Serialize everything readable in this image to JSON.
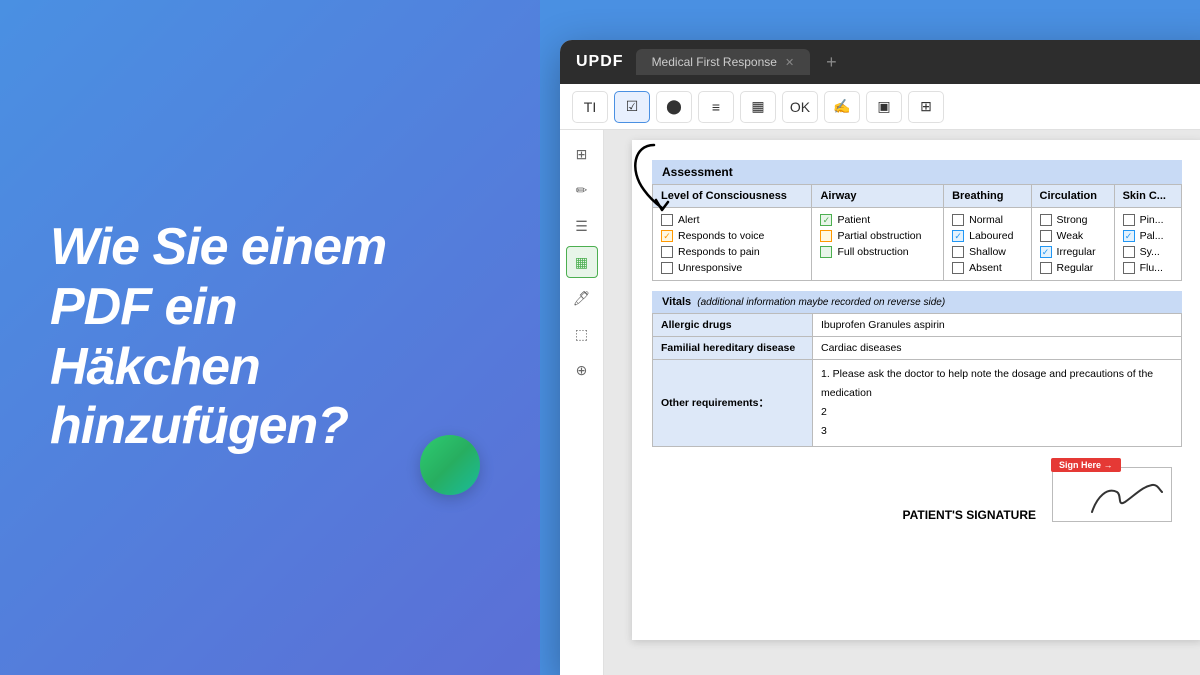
{
  "left": {
    "title_line1": "Wie Sie einem",
    "title_line2": "PDF ein",
    "title_line3": "Häkchen",
    "title_line4": "hinzufügen?"
  },
  "app": {
    "logo": "UPDF",
    "tab_label": "Medical First Response",
    "toolbar_buttons": [
      "TI",
      "☑",
      "⬤",
      "≡",
      "▦",
      "OK",
      "🖋",
      "▣",
      "⊞"
    ],
    "assessment_title": "Assessment",
    "columns": {
      "level_of_consciousness": "Level of Consciousness",
      "airway": "Airway",
      "breathing": "Breathing",
      "circulation": "Circulation",
      "skin_color": "Skin C..."
    },
    "loc_items": [
      {
        "label": "Alert",
        "checked": false,
        "type": "none"
      },
      {
        "label": "Responds to voice",
        "checked": true,
        "type": "orange"
      },
      {
        "label": "Responds to pain",
        "checked": false,
        "type": "none"
      },
      {
        "label": "Unresponsive",
        "checked": false,
        "type": "none"
      }
    ],
    "airway_items": [
      {
        "label": "Patient",
        "checked": true,
        "type": "green"
      },
      {
        "label": "Partial obstruction",
        "checked": false,
        "type": "orange"
      },
      {
        "label": "Full obstruction",
        "checked": false,
        "type": "green"
      }
    ],
    "breathing_items": [
      {
        "label": "Normal",
        "checked": false,
        "type": "none"
      },
      {
        "label": "Laboured",
        "checked": true,
        "type": "blue"
      },
      {
        "label": "Shallow",
        "checked": false,
        "type": "none"
      },
      {
        "label": "Absent",
        "checked": false,
        "type": "none"
      }
    ],
    "circulation_items": [
      {
        "label": "Strong",
        "checked": false,
        "type": "none"
      },
      {
        "label": "Weak",
        "checked": false,
        "type": "none"
      },
      {
        "label": "Irregular",
        "checked": true,
        "type": "blue"
      },
      {
        "label": "Regular",
        "checked": false,
        "type": "none"
      }
    ],
    "skin_items": [
      {
        "label": "Pin...",
        "checked": false,
        "type": "none"
      },
      {
        "label": "Pal...",
        "checked": true,
        "type": "blue"
      },
      {
        "label": "Sy...",
        "checked": false,
        "type": "none"
      },
      {
        "label": "Flu...",
        "checked": false,
        "type": "none"
      }
    ],
    "vitals_title": "Vitals",
    "vitals_subtitle": "(additional information maybe recorded on reverse side)",
    "vitals_rows": [
      {
        "label": "Allergic drugs",
        "value": "Ibuprofen Granules  aspirin"
      },
      {
        "label": "Familial hereditary disease",
        "value": "Cardiac diseases"
      },
      {
        "label": "Other requirements：",
        "value": "1. Please ask the doctor to help note the dosage and precautions of the medication\n2\n3"
      }
    ],
    "signature_label": "PATIENT'S SIGNATURE"
  }
}
